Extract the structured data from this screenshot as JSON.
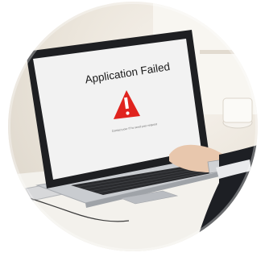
{
  "screen": {
    "title": "Application Failed",
    "subtitle": "Contact your IT to send your request"
  },
  "icons": {
    "alert": "warning-triangle-icon"
  },
  "colors": {
    "alert_red": "#e0231e",
    "laptop_body": "#c9ccd0",
    "bezel": "#1e1f22",
    "screen": "#f2f2f2",
    "background": "#ece6dc"
  }
}
